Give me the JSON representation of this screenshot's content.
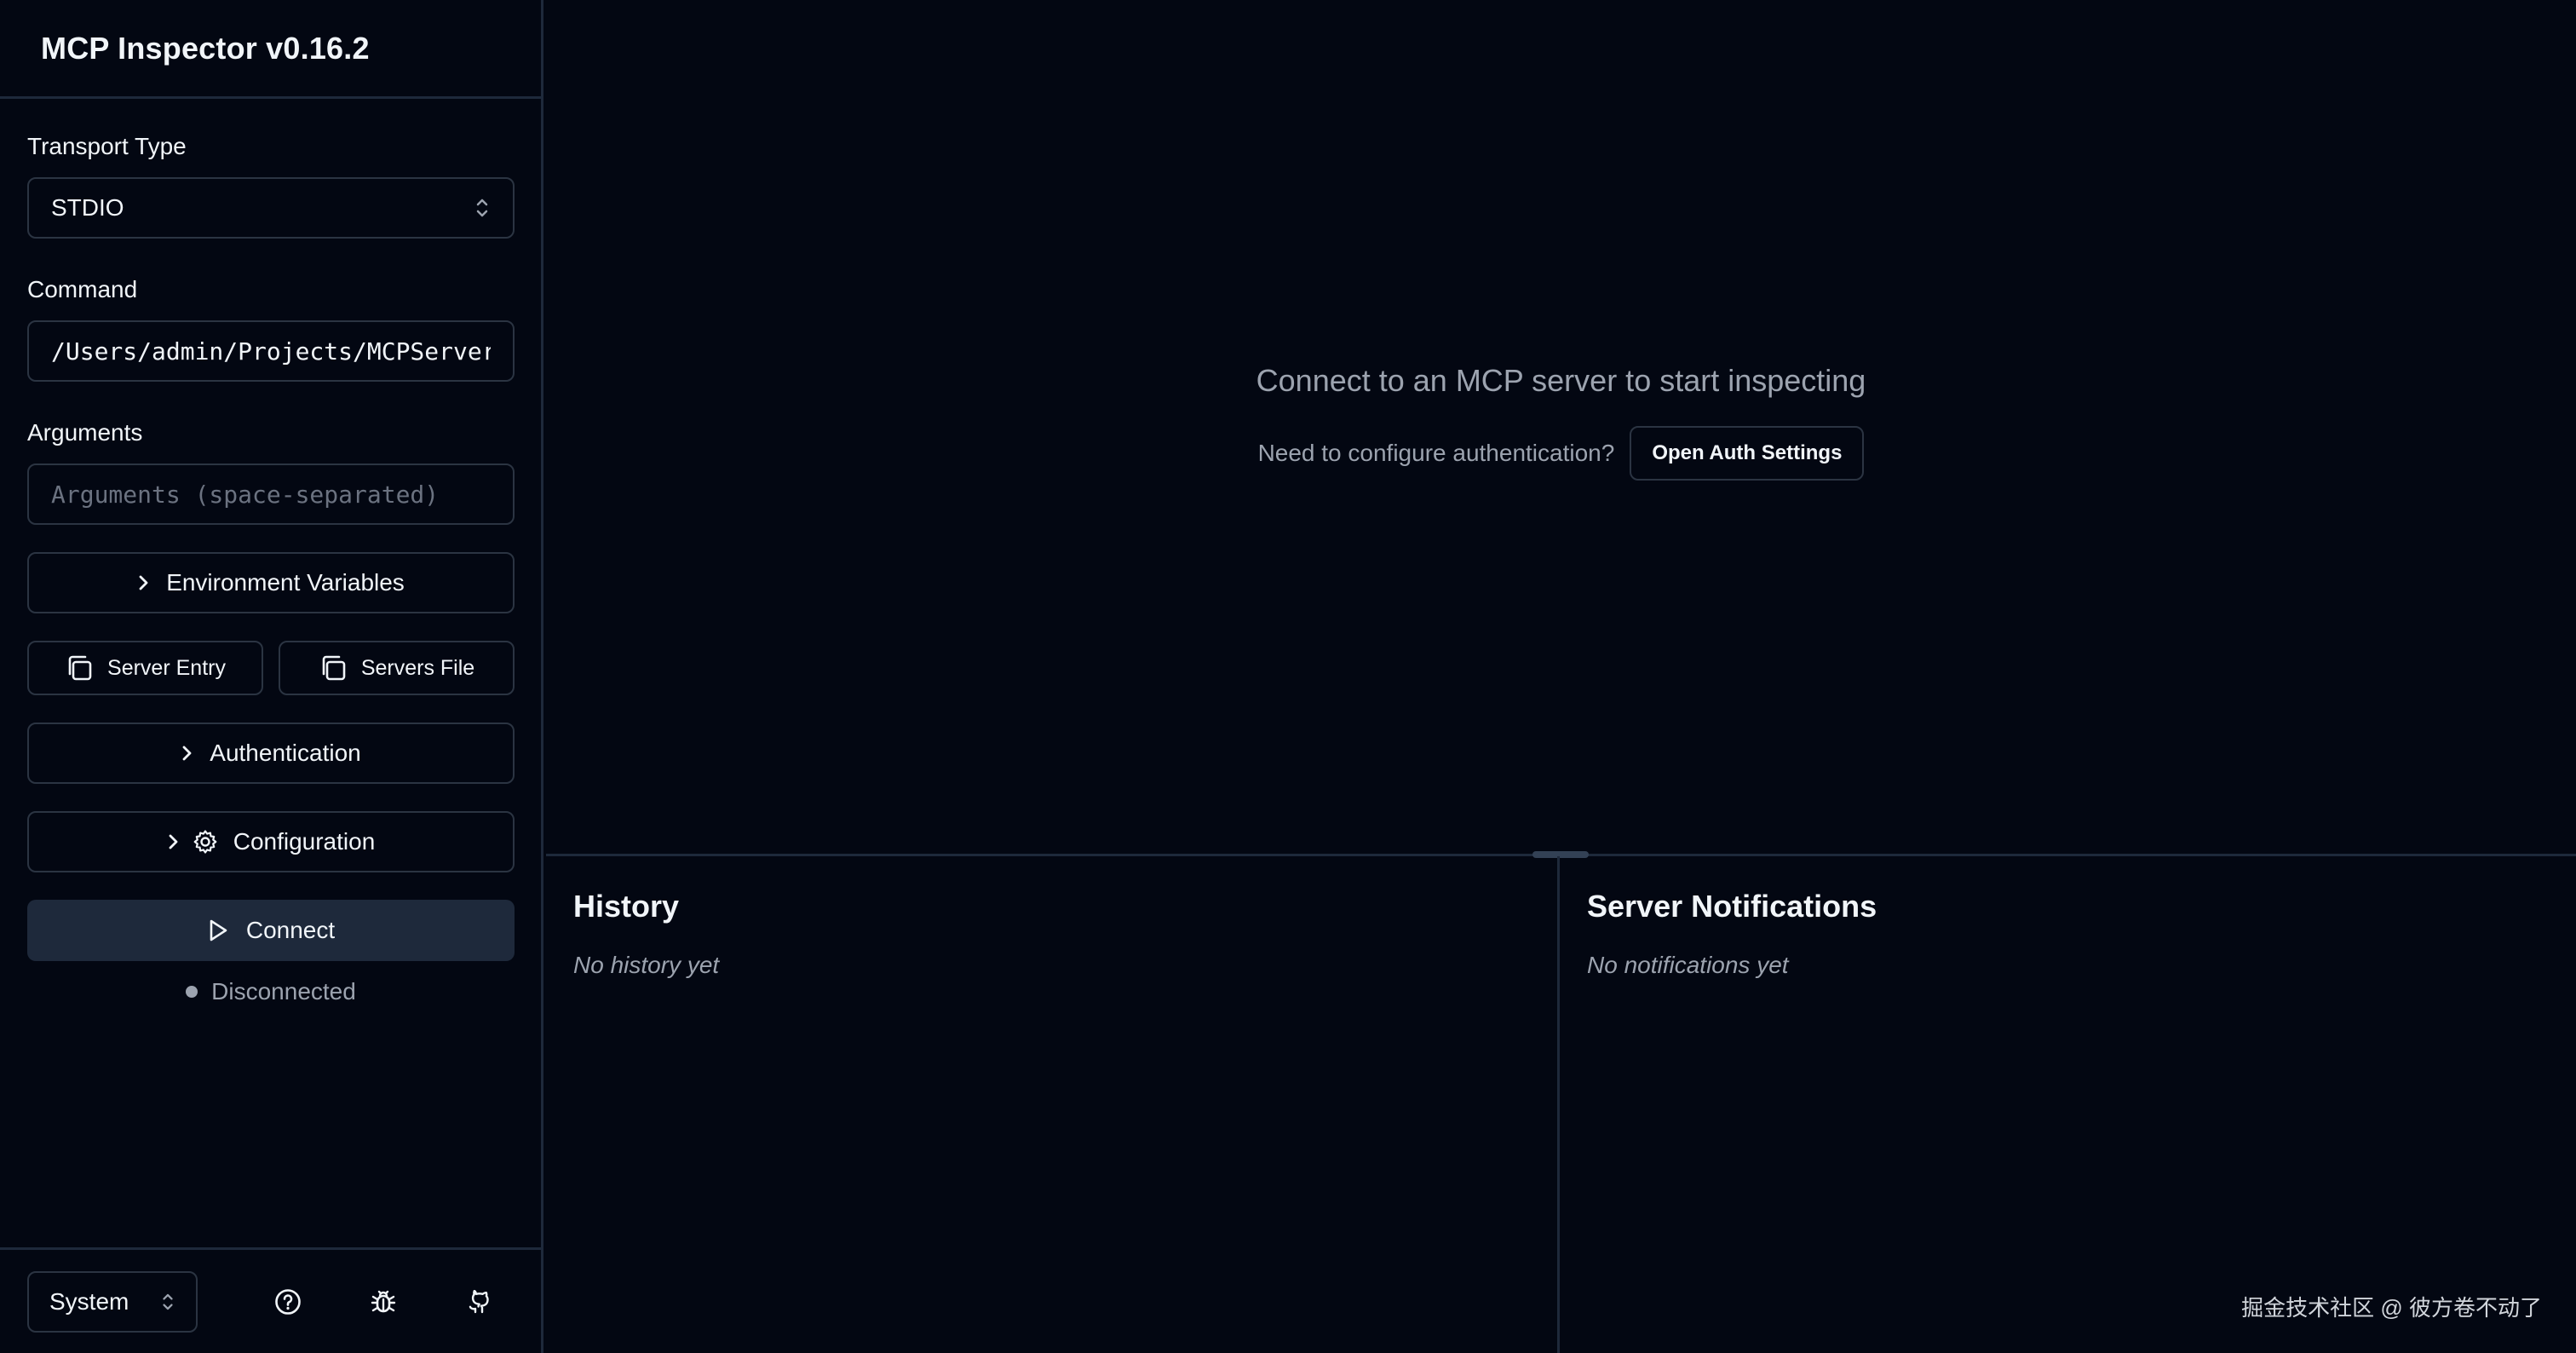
{
  "app": {
    "title": "MCP Inspector v0.16.2"
  },
  "sidebar": {
    "transport": {
      "label": "Transport Type",
      "value": "STDIO"
    },
    "command": {
      "label": "Command",
      "value": "/Users/admin/Projects/MCPServer"
    },
    "arguments": {
      "label": "Arguments",
      "placeholder": "Arguments (space-separated)"
    },
    "env_button": "Environment Variables",
    "server_entry_button": "Server Entry",
    "servers_file_button": "Servers File",
    "auth_button": "Authentication",
    "config_button": "Configuration",
    "connect_button": "Connect",
    "status": "Disconnected"
  },
  "footer": {
    "theme": "System",
    "icons": [
      "help-icon",
      "bug-icon",
      "github-icon"
    ]
  },
  "main": {
    "empty_title": "Connect to an MCP server to start inspecting",
    "auth_prompt": "Need to configure authentication?",
    "auth_button": "Open Auth Settings"
  },
  "history": {
    "title": "History",
    "empty": "No history yet"
  },
  "notifications": {
    "title": "Server Notifications",
    "empty": "No notifications yet"
  },
  "watermark": "掘金技术社区 @ 彼方卷不动了",
  "colors": {
    "background": "#030712",
    "border": "#1e293b",
    "connect_bg": "#1e293b",
    "muted": "#9ca3af"
  }
}
